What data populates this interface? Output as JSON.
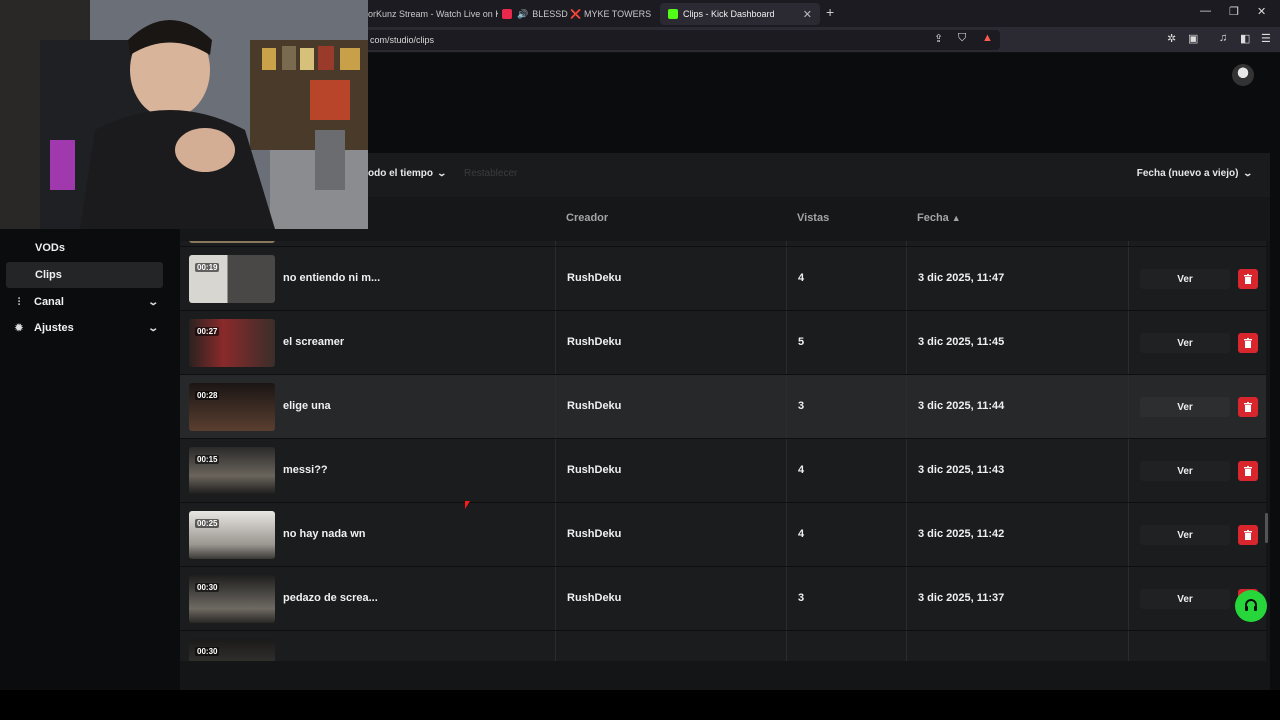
{
  "browser": {
    "tabs": [
      {
        "label": "orKunz Stream - Watch Live on K",
        "active": false
      },
      {
        "label": "BLESSD ❌ MYKE TOWERS ❌ C",
        "active": false
      },
      {
        "label": "Clips - Kick Dashboard",
        "active": true
      }
    ],
    "url": "com/studio/clips"
  },
  "sidebar": {
    "items": [
      {
        "label": "VODs",
        "icon": "none"
      },
      {
        "label": "Clips",
        "icon": "none",
        "active": true
      },
      {
        "label": "Canal",
        "icon": "sliders-icon"
      },
      {
        "label": "Ajustes",
        "icon": "gear-icon"
      }
    ]
  },
  "filters": {
    "time_label": "odo el tiempo",
    "reset_label": "Restablecer",
    "sort_label": "Fecha (nuevo a viejo)"
  },
  "table": {
    "headers": {
      "creator": "Creador",
      "views": "Vistas",
      "date": "Fecha"
    },
    "rows": [
      {
        "duration": "00:19",
        "title": "no entiendo ni m...",
        "creator": "RushDeku",
        "views": "4",
        "date": "3 dic 2025, 11:47",
        "action": "Ver"
      },
      {
        "duration": "00:27",
        "title": "el screamer",
        "creator": "RushDeku",
        "views": "5",
        "date": "3 dic 2025, 11:45",
        "action": "Ver"
      },
      {
        "duration": "00:28",
        "title": "elige una",
        "creator": "RushDeku",
        "views": "3",
        "date": "3 dic 2025, 11:44",
        "action": "Ver"
      },
      {
        "duration": "00:15",
        "title": "messi??",
        "creator": "RushDeku",
        "views": "4",
        "date": "3 dic 2025, 11:43",
        "action": "Ver"
      },
      {
        "duration": "00:25",
        "title": "no hay nada wn",
        "creator": "RushDeku",
        "views": "4",
        "date": "3 dic 2025, 11:42",
        "action": "Ver"
      },
      {
        "duration": "00:30",
        "title": "pedazo de screa...",
        "creator": "RushDeku",
        "views": "3",
        "date": "3 dic 2025, 11:37",
        "action": "Ver"
      }
    ],
    "partial_next_duration": "00:30"
  },
  "colors": {
    "accent_green": "#26d63a",
    "delete_red": "#d9262c"
  }
}
